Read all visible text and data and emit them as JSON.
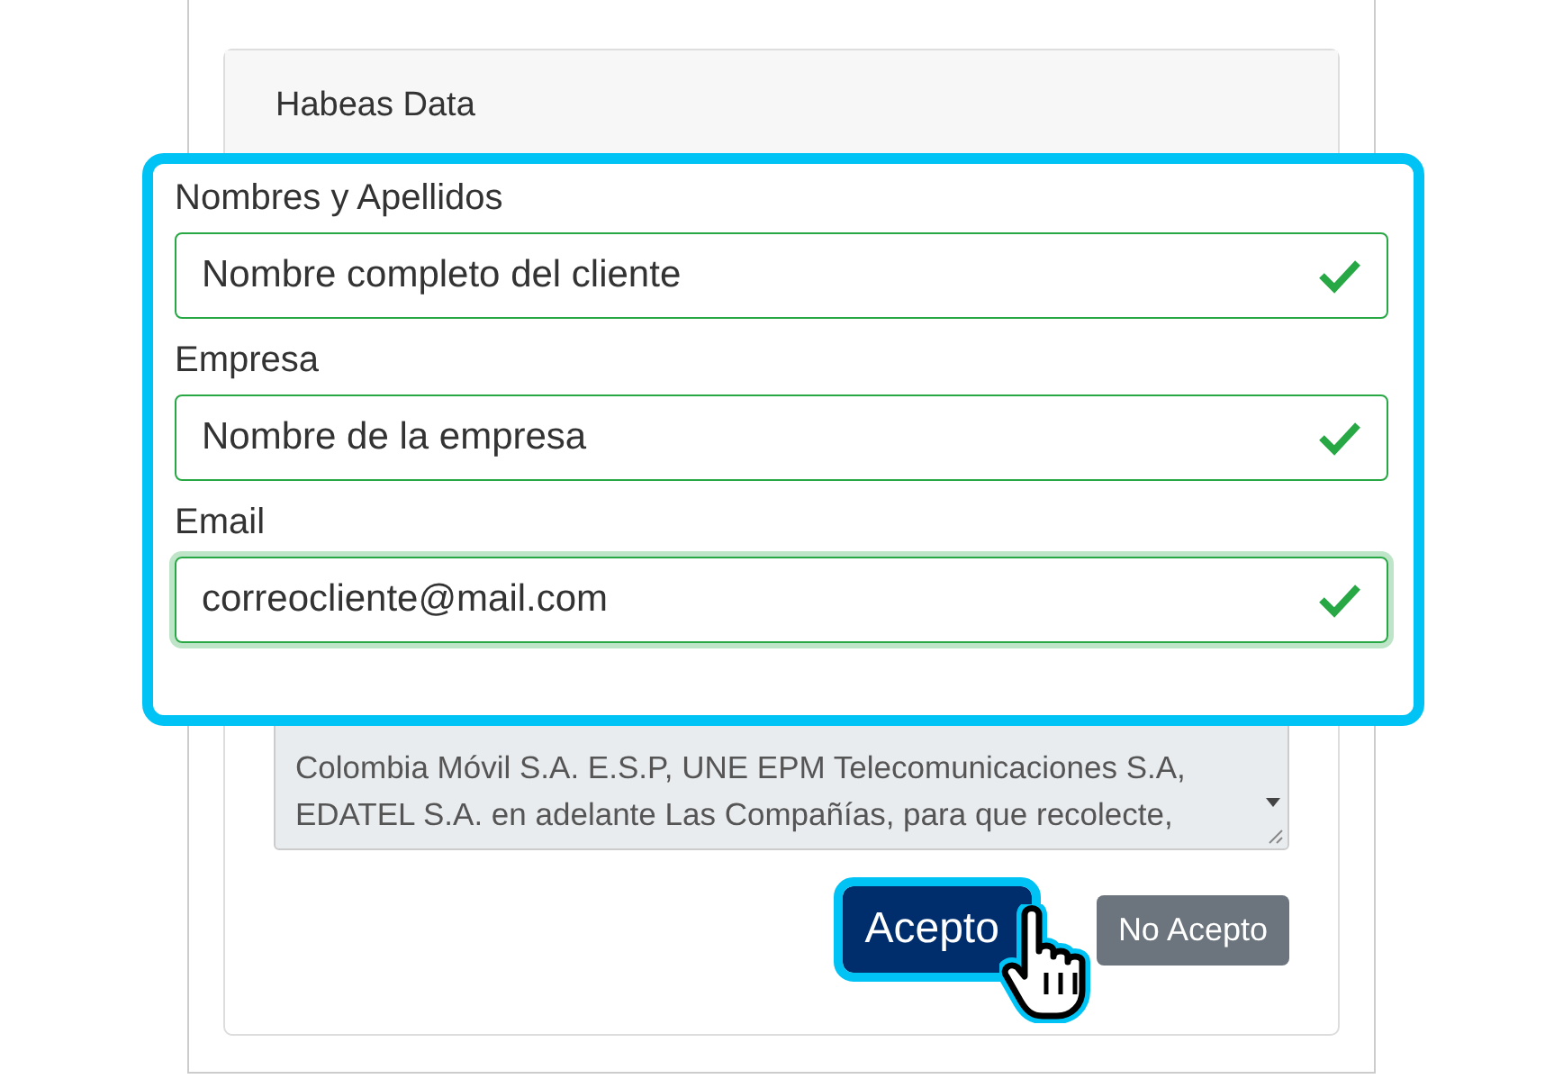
{
  "card": {
    "title": "Habeas Data"
  },
  "fields": [
    {
      "label": "Nombres y Apellidos",
      "value": "Nombre completo del cliente",
      "valid": true,
      "focused": false
    },
    {
      "label": "Empresa",
      "value": "Nombre de la empresa",
      "valid": true,
      "focused": false
    },
    {
      "label": "Email",
      "value": "correocliente@mail.com",
      "valid": true,
      "focused": true
    }
  ],
  "consent_text": [
    "Colombia Móvil S.A. E.S.P, UNE EPM Telecomunicaciones S.A,",
    "EDATEL S.A. en adelante Las Compañías, para que recolecte,"
  ],
  "buttons": [
    {
      "label": "Acepto",
      "kind": "primary",
      "highlighted": true
    },
    {
      "label": "No Acepto",
      "kind": "secondary",
      "highlighted": false
    }
  ]
}
